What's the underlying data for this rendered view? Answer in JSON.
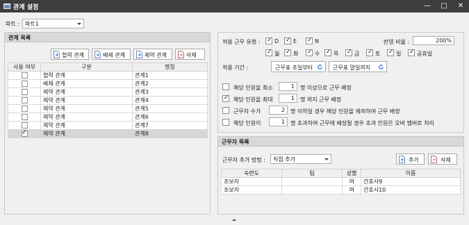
{
  "window": {
    "title": "관계 설정"
  },
  "part": {
    "label": "파트 :",
    "value": "파트1"
  },
  "left_panel": {
    "header": "관계 목록",
    "buttons": {
      "cooperate": "협력 관계",
      "exclude": "배제 관계",
      "restrict": "제약 관계",
      "delete": "삭제"
    },
    "columns": [
      "사용 여부",
      "구분",
      "명칭"
    ],
    "rows": [
      {
        "used": false,
        "type": "협력 관계",
        "name": "관계1"
      },
      {
        "used": false,
        "type": "배제 관계",
        "name": "관계2"
      },
      {
        "used": false,
        "type": "제약 관계",
        "name": "관계3"
      },
      {
        "used": false,
        "type": "제약 관계",
        "name": "관계4"
      },
      {
        "used": false,
        "type": "제약 관계",
        "name": "관계5"
      },
      {
        "used": false,
        "type": "제약 관계",
        "name": "관계6"
      },
      {
        "used": false,
        "type": "제약 관계",
        "name": "관계7"
      },
      {
        "used": true,
        "type": "제약 관계",
        "name": "관계8"
      }
    ]
  },
  "settings": {
    "work_type_label": "적용 근무 유형 :",
    "work_types": [
      {
        "label": "D",
        "checked": true
      },
      {
        "label": "E",
        "checked": true
      },
      {
        "label": "N",
        "checked": true
      }
    ],
    "ratio_label": "반영 비율 :",
    "ratio_value": "200%",
    "days": [
      {
        "label": "월",
        "checked": true
      },
      {
        "label": "화",
        "checked": true
      },
      {
        "label": "수",
        "checked": true
      },
      {
        "label": "목",
        "checked": true
      },
      {
        "label": "금",
        "checked": true
      },
      {
        "label": "토",
        "checked": true
      },
      {
        "label": "일",
        "checked": true
      },
      {
        "label": "공휴일",
        "checked": true
      }
    ],
    "period_label": "적용 기간 :",
    "period_start": "근무표 초일부터",
    "period_end": "근무표 말일까지",
    "rules": [
      {
        "checked": false,
        "prefix": "해당 인원을 최소",
        "value": "1",
        "suffix": "명 이상으로 근무 배정"
      },
      {
        "checked": true,
        "prefix": "해당 인원을 최대",
        "value": "1",
        "suffix": "명 까지 근무 배정"
      },
      {
        "checked": false,
        "prefix": "근무자 수가",
        "value": "2",
        "suffix": "명 이하일 경우 해당 인원을 제외하여 근무 배정"
      },
      {
        "checked": false,
        "prefix": "해당 인원이",
        "value": "1",
        "suffix": "명 초과하여 근무에 배정될 경우 초과 인원은 오버 멤버로 처리"
      }
    ]
  },
  "workers": {
    "header": "근무자 목록",
    "method_label": "근무자 추가 방법 :",
    "method_value": "직접 추가",
    "add_label": "추가",
    "delete_label": "삭제",
    "columns": [
      "숙련도",
      "팀",
      "성별",
      "이름"
    ],
    "rows": [
      {
        "skill": "조보자",
        "team": "",
        "gender": "여",
        "name": "간호사9"
      },
      {
        "skill": "조보자",
        "team": "",
        "gender": "여",
        "name": "간호사10"
      }
    ]
  }
}
